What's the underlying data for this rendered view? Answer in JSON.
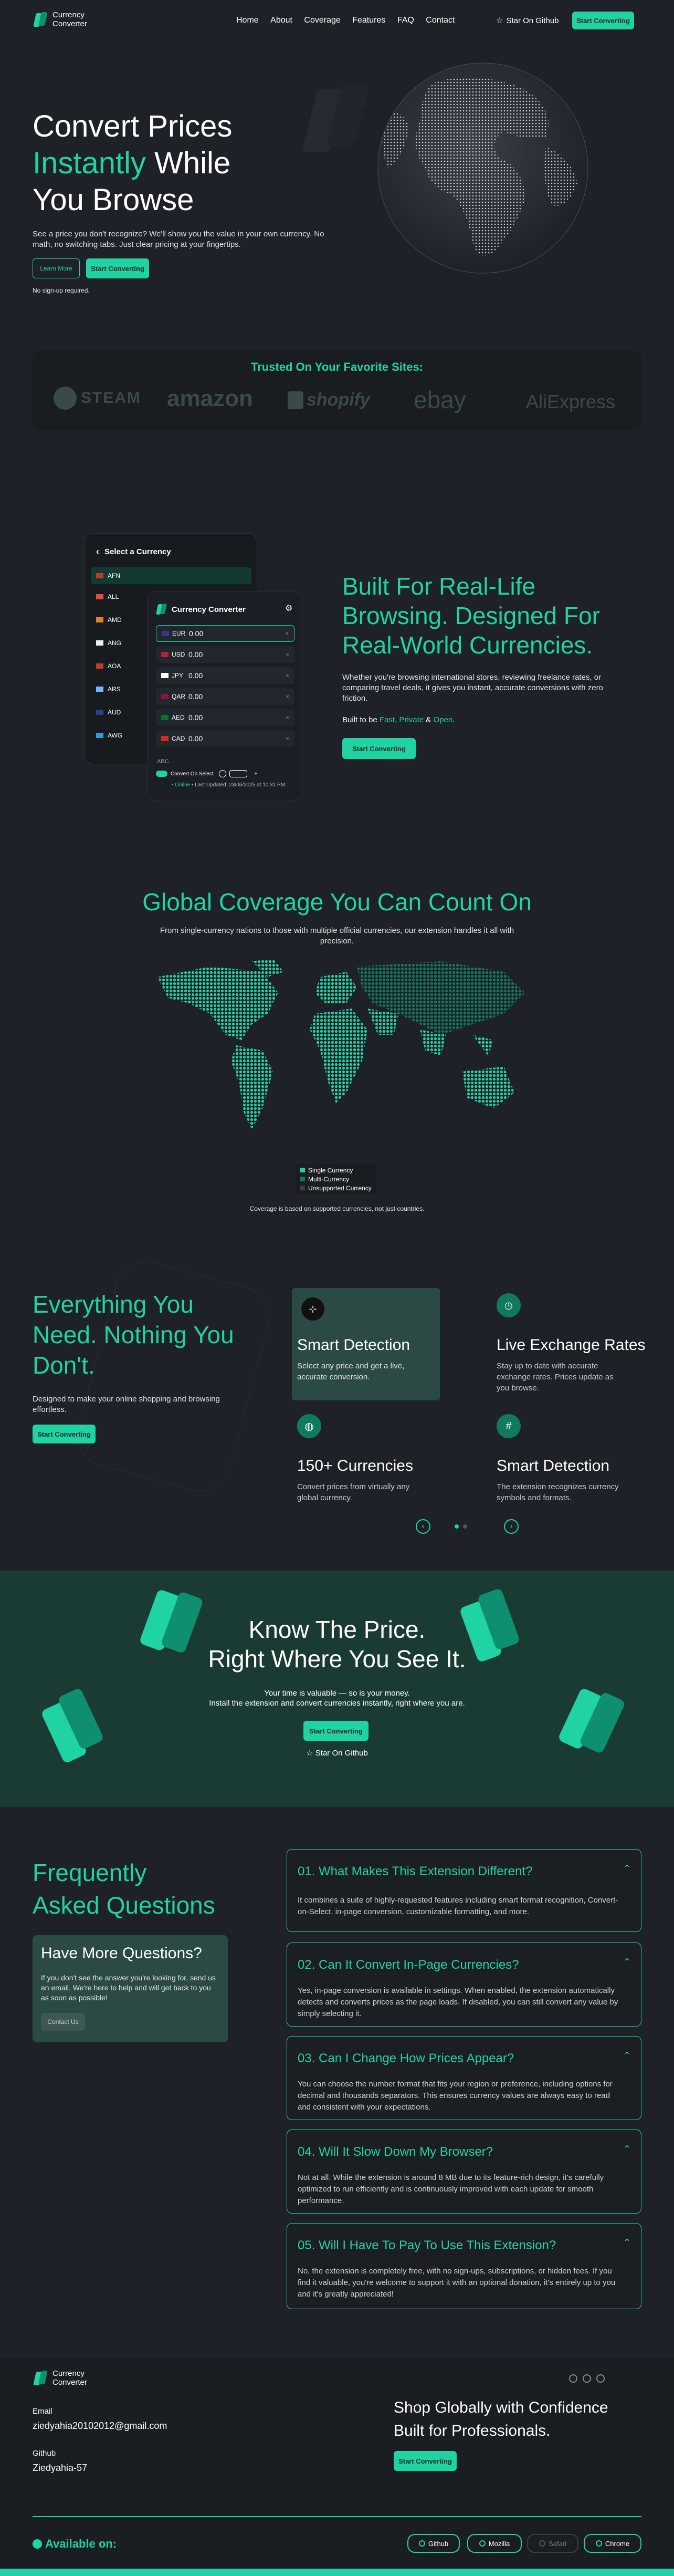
{
  "nav": {
    "brand_line1": "Currency",
    "brand_line2": "Converter",
    "links": [
      "Home",
      "About",
      "Coverage",
      "Features",
      "FAQ",
      "Contact"
    ],
    "star_label": "Star On Github",
    "cta": "Start Converting"
  },
  "hero": {
    "title_line1": "Convert Prices",
    "title_accent": "Instantly",
    "title_line2_rest": " While",
    "title_line3": "You Browse",
    "subtitle": "See a price you don't recognize? We'll show you the value in your own currency. No math, no switching tabs. Just clear pricing at your fingertips.",
    "learn_more": "Learn More",
    "cta": "Start Converting",
    "note": "No sign-up required."
  },
  "trusted": {
    "title": "Trusted On Your Favorite Sites:",
    "brands": [
      "STEAM",
      "amazon",
      "shopify",
      "ebay",
      "AliExpress"
    ]
  },
  "popup_back": {
    "title": "Select a Currency",
    "codes": [
      "AFN",
      "ALL",
      "AMD",
      "ANG",
      "AOA",
      "ARS",
      "AUD",
      "AWG"
    ]
  },
  "popup_front": {
    "title": "Currency Converter",
    "rows": [
      {
        "code": "EUR",
        "value": "0.00"
      },
      {
        "code": "USD",
        "value": "0.00"
      },
      {
        "code": "JPY",
        "value": "0.00"
      },
      {
        "code": "QAR",
        "value": "0.00"
      },
      {
        "code": "AED",
        "value": "0.00"
      },
      {
        "code": "CAD",
        "value": "0.00"
      }
    ],
    "format_sample": "ABC...",
    "convert_on_select": "Convert On Select",
    "status": "• Online",
    "last_updated": "• Last Updated: 23/06/2025 at 10:31 PM"
  },
  "browsing": {
    "title": "Built For Real-Life Browsing. Designed For Real-World Currencies.",
    "text": "Whether you're browsing international stores, reviewing freelance rates, or comparing travel deals, it gives you instant, accurate conversions with zero friction.",
    "built_prefix": "Built to be ",
    "built_fast": "Fast",
    "built_private": "Private",
    "built_open": "Open",
    "cta": "Start Converting"
  },
  "coverage": {
    "title": "Global Coverage You Can Count On",
    "subtitle": "From single-currency nations to those with multiple official currencies, our extension handles it all with precision.",
    "legend": [
      "Single Currency",
      "Multi-Currency",
      "Unsupported Currency"
    ],
    "note": "Coverage is based on supported currencies, not just countries.",
    "colors": {
      "single": "#20d3a5",
      "multi": "#0f7a60",
      "unsupported": "#3b4047"
    }
  },
  "features": {
    "title": "Everything You Need. Nothing You Don't.",
    "subtitle": "Designed to make your online shopping and browsing effortless.",
    "cta": "Start Converting",
    "cards": [
      {
        "icon": "cursor-icon",
        "title": "Smart Detection",
        "text": "Select any price and get a live, accurate conversion."
      },
      {
        "icon": "clock-icon",
        "title": "Live Exchange Rates",
        "text": "Stay up to date with accurate exchange rates. Prices update as you browse."
      },
      {
        "icon": "globe-icon",
        "title": "150+ Currencies",
        "text": "Convert prices from virtually any global currency."
      },
      {
        "icon": "hash-icon",
        "title": "Smart Detection",
        "text": "The extension recognizes currency symbols and formats."
      }
    ]
  },
  "know": {
    "title_line1": "Know The Price.",
    "title_line2": "Right Where You See It.",
    "text_line1": "Your time is valuable — so is your money.",
    "text_line2": "Install the extension and convert currencies instantly, right where you are.",
    "cta": "Start Converting",
    "star_label": "Star On Github"
  },
  "faq": {
    "title_line1": "Frequently",
    "title_line2": "Asked Questions",
    "more_title": "Have More Questions?",
    "more_text": "If you don't see the answer you're looking for, send us an email. We're here to help and will get back to you as soon as possible!",
    "contact": "Contact Us",
    "items": [
      {
        "q": "01.  What Makes This Extension Different?",
        "a": "It combines a suite of highly-requested features including smart format recognition, Convert-on-Select, in-page conversion, customizable formatting, and more."
      },
      {
        "q": "02.  Can It Convert In-Page Currencies?",
        "a": "Yes, in-page conversion is available in settings. When enabled, the extension automatically detects and converts prices as the page loads. If disabled, you can still convert any value by simply selecting it."
      },
      {
        "q": "03.  Can I Change How Prices Appear?",
        "a": "You can choose the number format that fits your region or preference, including options for decimal and thousands separators. This ensures currency values are always easy to read and consistent with your expectations."
      },
      {
        "q": "04.  Will It Slow Down My Browser?",
        "a": "Not at all. While the extension is around 8 MB due to its feature-rich design, it's carefully optimized to run efficiently and is continuously improved with each update for smooth performance."
      },
      {
        "q": "05.  Will I Have To Pay To Use This Extension?",
        "a": "No, the extension is completely free, with no sign-ups, subscriptions, or hidden fees. If you find it valuable, you're welcome to support it with an optional donation, it's entirely up to you and it's greatly appreciated!"
      }
    ]
  },
  "footer": {
    "brand_line1": "Currency",
    "brand_line2": "Converter",
    "email_label": "Email",
    "email": "ziedyahia20102012@gmail.com",
    "github_label": "Github",
    "github": "Ziedyahia-57",
    "tagline_line1": "Shop Globally with Confidence",
    "tagline_line2": "Built for Professionals.",
    "cta": "Start Converting",
    "available": "Available on:",
    "stores": [
      "Github",
      "Mozilla",
      "Safari",
      "Chrome"
    ]
  }
}
